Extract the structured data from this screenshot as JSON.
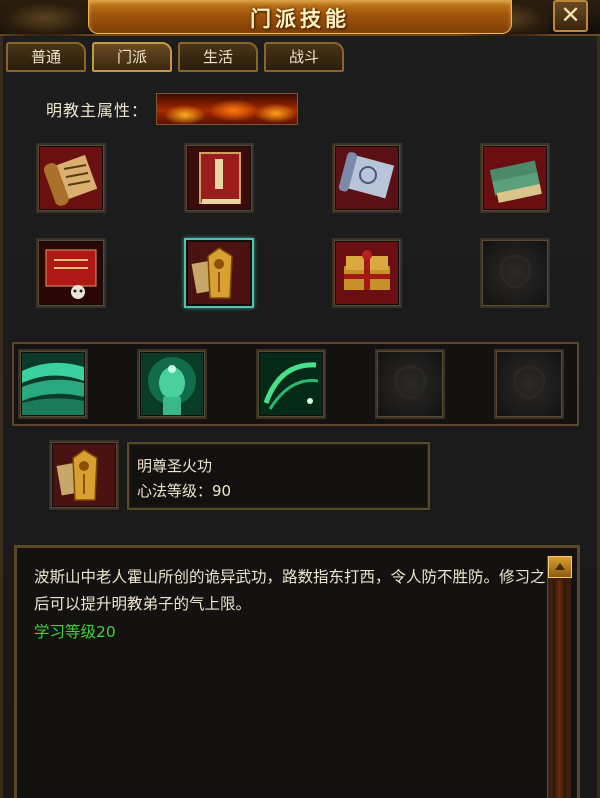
{
  "window": {
    "title": "门派技能",
    "close_label": "✕"
  },
  "tabs": [
    {
      "label": "普通",
      "active": false
    },
    {
      "label": "门派",
      "active": true
    },
    {
      "label": "生活",
      "active": false
    },
    {
      "label": "战斗",
      "active": false
    }
  ],
  "attribute": {
    "label": "明教主属性：",
    "element": "fire"
  },
  "skill_grid": {
    "row1": [
      "scroll-icon",
      "red-book-icon",
      "silver-scroll-icon",
      "green-books-icon"
    ],
    "row2": [
      "red-scroll-skull-icon",
      "golden-tablet-icon",
      "gift-books-icon",
      "empty-slot"
    ],
    "row3": [
      "green-wave-icon",
      "jade-head-icon",
      "green-swirl-icon",
      "empty-slot",
      "empty-slot"
    ],
    "selected": "golden-tablet-icon"
  },
  "selected_skill": {
    "name": "明尊圣火功",
    "level_text": "心法等级：90"
  },
  "description": {
    "text": "波斯山中老人霍山所创的诡异武功，路数指东打西，令人防不胜防。修习之后可以提升明教弟子的气上限。",
    "requirement": "学习等级20"
  },
  "colors": {
    "accent_gold": "#c7811f",
    "requirement_green": "#3fd43a",
    "selected_border": "#55c0b0"
  }
}
